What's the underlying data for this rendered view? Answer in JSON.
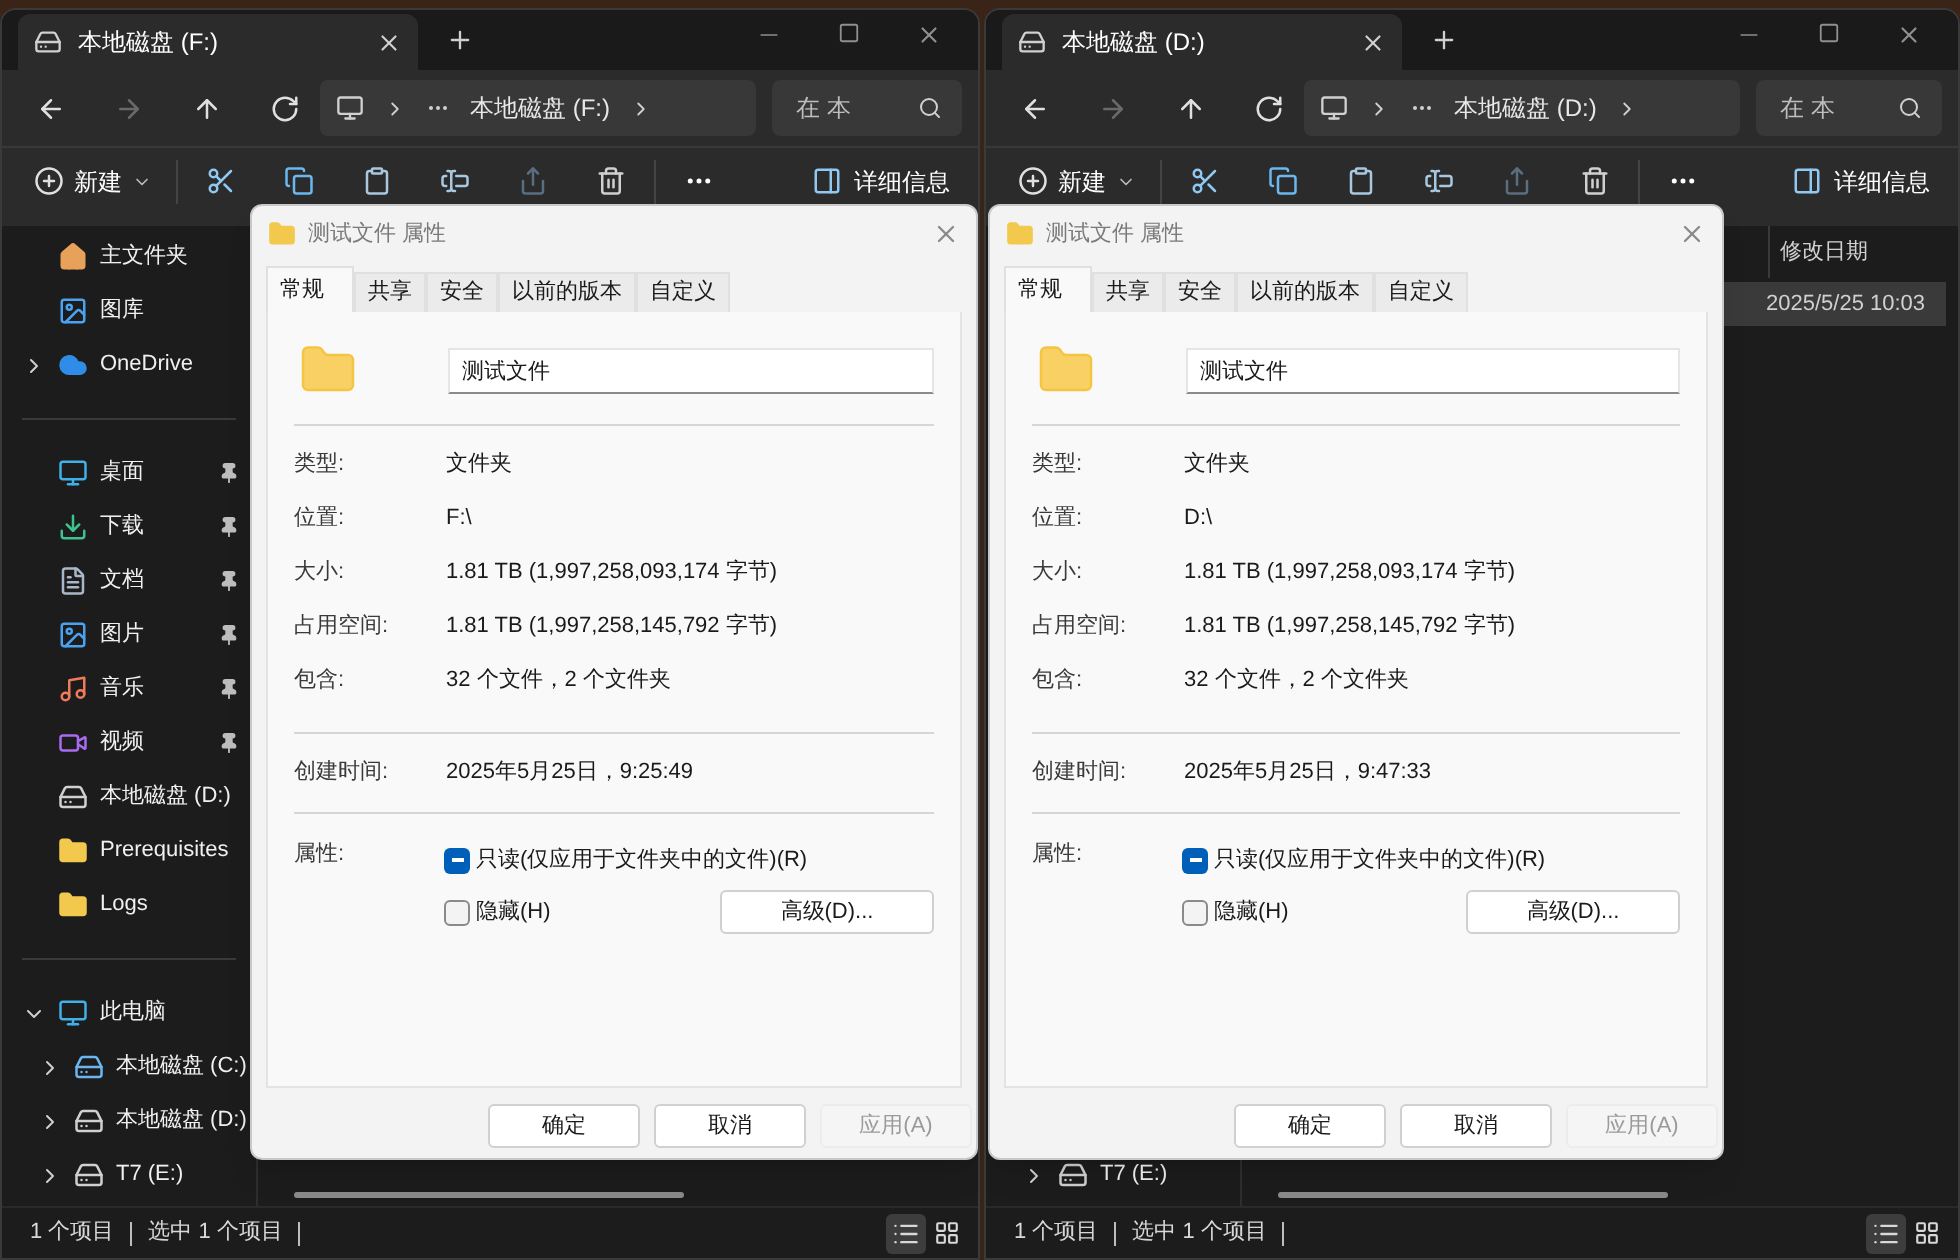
{
  "windows": [
    {
      "tab": {
        "title": "本地磁盘 (F:)"
      },
      "address": {
        "path": "本地磁盘 (F:)"
      },
      "search": {
        "placeholder": "在 本"
      },
      "toolbar": {
        "new": "新建",
        "details": "详细信息"
      },
      "sidebar": {
        "groups": [
          [
            {
              "label": "主文件夹",
              "kind": "home"
            },
            {
              "label": "图库",
              "kind": "gallery"
            },
            {
              "label": "OneDrive",
              "kind": "cloud",
              "expanded": false
            }
          ],
          [
            {
              "label": "桌面",
              "kind": "desktop",
              "pinned": true
            },
            {
              "label": "下载",
              "kind": "download",
              "pinned": true
            },
            {
              "label": "文档",
              "kind": "document",
              "pinned": true
            },
            {
              "label": "图片",
              "kind": "gallery",
              "pinned": true
            },
            {
              "label": "音乐",
              "kind": "music",
              "pinned": true
            },
            {
              "label": "视频",
              "kind": "video",
              "pinned": true
            },
            {
              "label": "本地磁盘 (D:)",
              "kind": "drive",
              "pinned": false
            },
            {
              "label": "Prerequisites",
              "kind": "folder",
              "pinned": false
            },
            {
              "label": "Logs",
              "kind": "folder",
              "pinned": false
            }
          ],
          [
            {
              "label": "此电脑",
              "kind": "pc",
              "expanded": true,
              "children": [
                {
                  "label": "本地磁盘 (C:)",
                  "kind": "system-drive",
                  "expanded": false
                },
                {
                  "label": "本地磁盘 (D:)",
                  "kind": "drive",
                  "expanded": false
                },
                {
                  "label": "T7 (E:)",
                  "kind": "drive",
                  "expanded": false
                }
              ]
            }
          ]
        ]
      },
      "status_bar": {
        "count": "1 个项目",
        "selection": "选中 1 个项目",
        "view_buttons": [
          {
            "kind": "details",
            "selected": true
          },
          {
            "kind": "tiles",
            "selected": false
          }
        ]
      },
      "dialog": {
        "title": "测试文件 属性",
        "tabs": [
          {
            "label": "常规",
            "selected": true
          },
          {
            "label": "共享",
            "selected": false
          },
          {
            "label": "安全",
            "selected": false
          },
          {
            "label": "以前的版本",
            "selected": false
          },
          {
            "label": "自定义",
            "selected": false
          }
        ],
        "name": "测试文件",
        "sections": [
          [
            {
              "label": "类型:",
              "value": "文件夹"
            },
            {
              "label": "位置:",
              "value": "F:\\"
            },
            {
              "label": "大小:",
              "value": "1.81 TB (1,997,258,093,174 字节)"
            },
            {
              "label": "占用空间:",
              "value": "1.81 TB (1,997,258,145,792 字节)"
            },
            {
              "label": "包含:",
              "value": "32 个文件，2 个文件夹"
            }
          ],
          [
            {
              "label": "创建时间:",
              "value": "2025年5月25日，9:25:49"
            }
          ]
        ],
        "attributes": {
          "label": "属性:",
          "options": [
            {
              "label": "只读(仅应用于文件夹中的文件)(R)",
              "checked": true,
              "mixed": true
            },
            {
              "label": "隐藏(H)",
              "checked": false
            }
          ],
          "advanced": "高级(D)..."
        },
        "buttons": [
          {
            "label": "确定",
            "disabled": false
          },
          {
            "label": "取消",
            "disabled": false
          },
          {
            "label": "应用(A)",
            "disabled": true
          }
        ]
      }
    },
    {
      "tab": {
        "title": "本地磁盘 (D:)"
      },
      "address": {
        "path": "本地磁盘 (D:)"
      },
      "search": {
        "placeholder": "在 本"
      },
      "toolbar": {
        "new": "新建",
        "details": "详细信息"
      },
      "sidebar": {
        "groups": [
          [
            {
              "children": [
                {
                  "label": "T7 (E:)",
                  "kind": "drive",
                  "expanded": false
                }
              ]
            }
          ]
        ]
      },
      "columns": [
        {
          "label": "修改日期"
        }
      ],
      "rows": [
        {
          "cells": [
            "2025/5/25 10:03"
          ],
          "selected": true
        }
      ],
      "status_bar": {
        "count": "1 个项目",
        "selection": "选中 1 个项目",
        "view_buttons": [
          {
            "kind": "details",
            "selected": true
          },
          {
            "kind": "tiles",
            "selected": false
          }
        ]
      },
      "dialog": {
        "title": "测试文件 属性",
        "tabs": [
          {
            "label": "常规",
            "selected": true
          },
          {
            "label": "共享",
            "selected": false
          },
          {
            "label": "安全",
            "selected": false
          },
          {
            "label": "以前的版本",
            "selected": false
          },
          {
            "label": "自定义",
            "selected": false
          }
        ],
        "name": "测试文件",
        "sections": [
          [
            {
              "label": "类型:",
              "value": "文件夹"
            },
            {
              "label": "位置:",
              "value": "D:\\"
            },
            {
              "label": "大小:",
              "value": "1.81 TB (1,997,258,093,174 字节)"
            },
            {
              "label": "占用空间:",
              "value": "1.81 TB (1,997,258,145,792 字节)"
            },
            {
              "label": "包含:",
              "value": "32 个文件，2 个文件夹"
            }
          ],
          [
            {
              "label": "创建时间:",
              "value": "2025年5月25日，9:47:33"
            }
          ]
        ],
        "attributes": {
          "label": "属性:",
          "options": [
            {
              "label": "只读(仅应用于文件夹中的文件)(R)",
              "checked": true,
              "mixed": true
            },
            {
              "label": "隐藏(H)",
              "checked": false
            }
          ],
          "advanced": "高级(D)..."
        },
        "buttons": [
          {
            "label": "确定",
            "disabled": false
          },
          {
            "label": "取消",
            "disabled": false
          },
          {
            "label": "应用(A)",
            "disabled": true
          }
        ]
      }
    }
  ]
}
